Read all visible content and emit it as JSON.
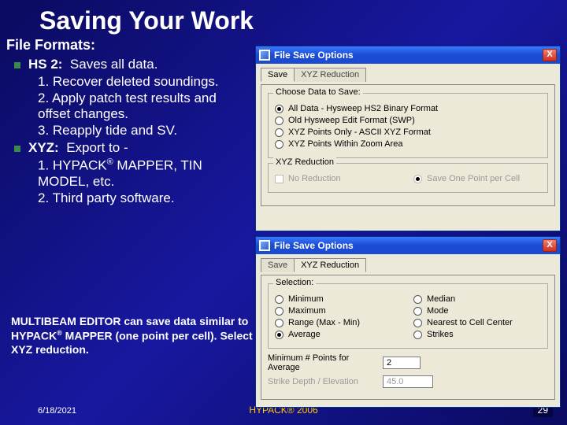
{
  "title": "Saving Your Work",
  "subheading": "File Formats:",
  "bullets": {
    "hs2": {
      "label": "HS 2:",
      "desc": "Saves all data."
    },
    "hs2_items": [
      "Recover deleted soundings.",
      "Apply patch test results and offset changes.",
      "Reapply tide and SV."
    ],
    "xyz": {
      "label": "XYZ:",
      "desc": "Export to -"
    },
    "xyz_items": [
      {
        "pre": "HYPACK",
        "sup": "®",
        "post": " MAPPER, TIN MODEL, etc."
      },
      {
        "text": "Third party software."
      }
    ]
  },
  "note": {
    "pre": "MULTIBEAM EDITOR can save data similar to HYPACK",
    "sup": "®",
    "post": " MAPPER (one point per cell). Select XYZ reduction."
  },
  "footer": {
    "date": "6/18/2021",
    "center": "HYPACK® 2006",
    "page": "29"
  },
  "dialog": {
    "title": "File Save Options",
    "close": "X",
    "tabs": {
      "save": "Save",
      "xyz": "XYZ Reduction"
    },
    "save_panel": {
      "group1_legend": "Choose Data to Save:",
      "opt_all": "All Data - Hysweep HS2 Binary Format",
      "opt_old": "Old Hysweep Edit Format (SWP)",
      "opt_xyzonly": "XYZ Points Only - ASCII XYZ Format",
      "opt_zoom": "XYZ Points Within Zoom Area",
      "group2_legend": "XYZ Reduction",
      "chk_noreduce": "No Reduction",
      "rdo_onepoint": "Save One Point per Cell"
    },
    "xyz_panel": {
      "group_legend": "Selection:",
      "opt_min": "Minimum",
      "opt_max": "Maximum",
      "opt_range": "Range (Max - Min)",
      "opt_avg": "Average",
      "opt_median": "Median",
      "opt_mode": "Mode",
      "opt_nearest": "Nearest to Cell Center",
      "opt_strikes": "Strikes",
      "field_minpts": "Minimum # Points for Average",
      "field_minpts_val": "2",
      "field_depth": "Strike Depth / Elevation",
      "field_depth_val": "45.0"
    }
  }
}
